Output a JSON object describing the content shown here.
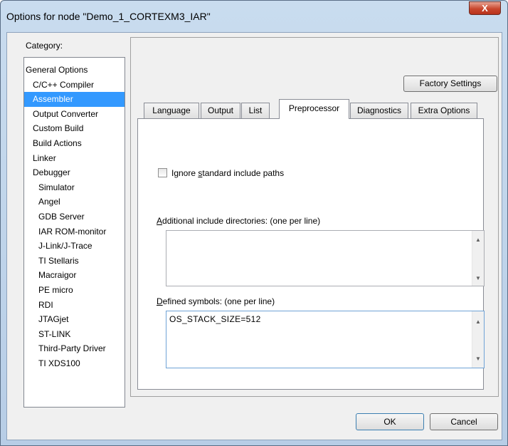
{
  "window": {
    "title": "Options for node \"Demo_1_CORTEXM3_IAR\"",
    "close_label": "X"
  },
  "category_label": "Category:",
  "categories": [
    {
      "label": "General Options",
      "level": 0,
      "selected": false
    },
    {
      "label": "C/C++ Compiler",
      "level": 1,
      "selected": false
    },
    {
      "label": "Assembler",
      "level": 1,
      "selected": true
    },
    {
      "label": "Output Converter",
      "level": 1,
      "selected": false
    },
    {
      "label": "Custom Build",
      "level": 1,
      "selected": false
    },
    {
      "label": "Build Actions",
      "level": 1,
      "selected": false
    },
    {
      "label": "Linker",
      "level": 1,
      "selected": false
    },
    {
      "label": "Debugger",
      "level": 1,
      "selected": false
    },
    {
      "label": "Simulator",
      "level": 2,
      "selected": false
    },
    {
      "label": "Angel",
      "level": 2,
      "selected": false
    },
    {
      "label": "GDB Server",
      "level": 2,
      "selected": false
    },
    {
      "label": "IAR ROM-monitor",
      "level": 2,
      "selected": false
    },
    {
      "label": "J-Link/J-Trace",
      "level": 2,
      "selected": false
    },
    {
      "label": "TI Stellaris",
      "level": 2,
      "selected": false
    },
    {
      "label": "Macraigor",
      "level": 2,
      "selected": false
    },
    {
      "label": "PE micro",
      "level": 2,
      "selected": false
    },
    {
      "label": "RDI",
      "level": 2,
      "selected": false
    },
    {
      "label": "JTAGjet",
      "level": 2,
      "selected": false
    },
    {
      "label": "ST-LINK",
      "level": 2,
      "selected": false
    },
    {
      "label": "Third-Party Driver",
      "level": 2,
      "selected": false
    },
    {
      "label": "TI XDS100",
      "level": 2,
      "selected": false
    }
  ],
  "factory_settings_label": "Factory Settings",
  "tabs": [
    {
      "label": "Language",
      "active": false
    },
    {
      "label": "Output",
      "active": false
    },
    {
      "label": "List",
      "active": false
    },
    {
      "label": "Preprocessor",
      "active": true
    },
    {
      "label": "Diagnostics",
      "active": false
    },
    {
      "label": "Extra Options",
      "active": false
    }
  ],
  "preprocessor": {
    "ignore_paths_prefix": "Ignore ",
    "ignore_paths_key": "s",
    "ignore_paths_suffix": "tandard include paths",
    "ignore_paths_checked": false,
    "include_label_key": "A",
    "include_label_rest": "dditional include directories:  (one per line)",
    "include_dirs_value": "",
    "defined_label_key": "D",
    "defined_label_rest": "efined symbols:  (one per line)",
    "defined_symbols_value": "OS_STACK_SIZE=512"
  },
  "buttons": {
    "ok_label": "OK",
    "cancel_label": "Cancel"
  },
  "scroll_icons": {
    "up": "▲",
    "down": "▼"
  }
}
